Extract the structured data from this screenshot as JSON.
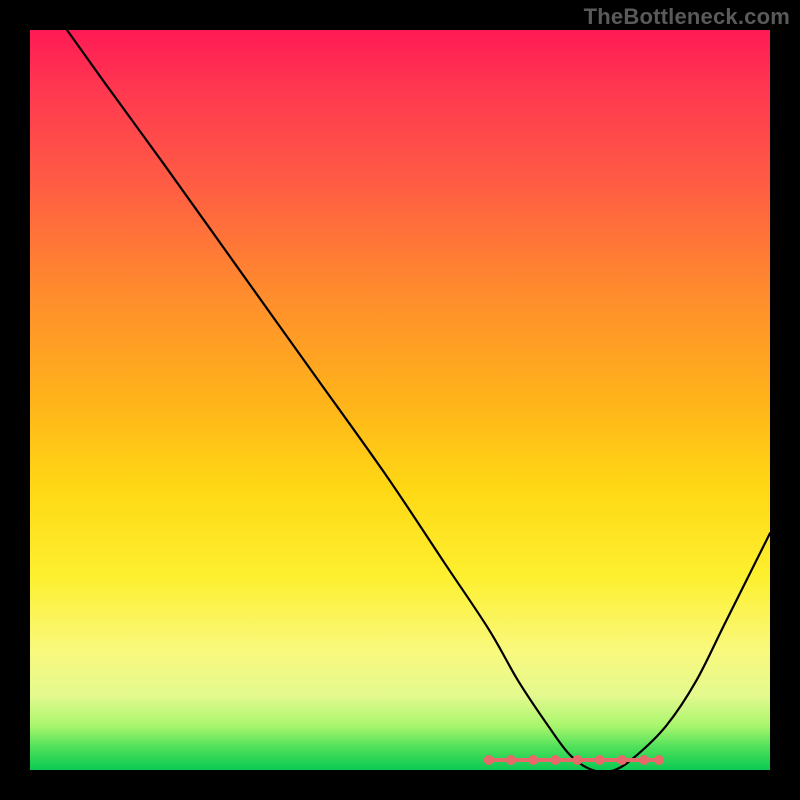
{
  "watermark": "TheBottleneck.com",
  "chart_data": {
    "type": "line",
    "title": "",
    "xlabel": "",
    "ylabel": "",
    "xlim": [
      0,
      100
    ],
    "ylim": [
      0,
      100
    ],
    "x": [
      5,
      10,
      18,
      28,
      38,
      48,
      56,
      62,
      66,
      70,
      73,
      76,
      79,
      82,
      86,
      90,
      94,
      100
    ],
    "values": [
      100,
      93,
      82,
      68,
      54,
      40,
      28,
      19,
      12,
      6,
      2,
      0,
      0,
      2,
      6,
      12,
      20,
      32
    ],
    "annotations": {
      "bottom_markers_x": [
        62,
        65,
        68,
        71,
        74,
        77,
        80,
        83,
        85
      ]
    },
    "gradient_stops": [
      {
        "pos": 0,
        "color": "#ff1a55"
      },
      {
        "pos": 35,
        "color": "#ff8a2e"
      },
      {
        "pos": 62,
        "color": "#ffd814"
      },
      {
        "pos": 84,
        "color": "#f9f97e"
      },
      {
        "pos": 100,
        "color": "#0aca54"
      }
    ]
  }
}
